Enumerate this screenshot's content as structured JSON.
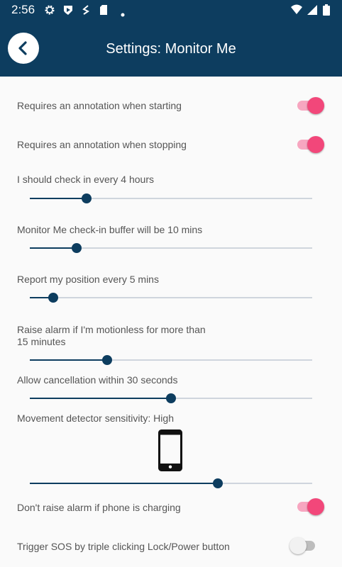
{
  "status_bar": {
    "time": "2:56",
    "icons": [
      "gear-icon",
      "shield-icon",
      "s-app-icon",
      "sd-card-icon",
      "dot-icon",
      "wifi-icon",
      "signal-icon",
      "battery-icon"
    ]
  },
  "header": {
    "title": "Settings: Monitor Me",
    "back_icon": "chevron-left-icon"
  },
  "colors": {
    "header": "#0d3d5f",
    "toggle_on": "#f2477a",
    "toggle_on_track": "#f7a6c0",
    "slider": "#0d3d5f"
  },
  "settings": {
    "annotation_start": {
      "label": "Requires an annotation when starting",
      "on": true
    },
    "annotation_stop": {
      "label": "Requires an annotation when stopping",
      "on": true
    },
    "checkin": {
      "label": "I should check in every 4 hours",
      "fraction": 0.2
    },
    "buffer": {
      "label": "Monitor Me check-in buffer will be 10 mins",
      "fraction": 0.167
    },
    "position": {
      "label": "Report my position every 5 mins",
      "fraction": 0.083
    },
    "motionless": {
      "line1": "Raise alarm if I'm motionless for more than",
      "line2": "15 minutes",
      "fraction": 0.275
    },
    "cancellation": {
      "label": "Allow cancellation within 30 seconds",
      "fraction": 0.5
    },
    "sensitivity": {
      "label": "Movement detector sensitivity: High",
      "fraction": 0.667,
      "icon": "phone-icon"
    },
    "charging": {
      "label": "Don't raise alarm if phone is charging",
      "on": true
    },
    "sos": {
      "label": "Trigger SOS by triple clicking Lock/Power button",
      "on": false
    }
  }
}
